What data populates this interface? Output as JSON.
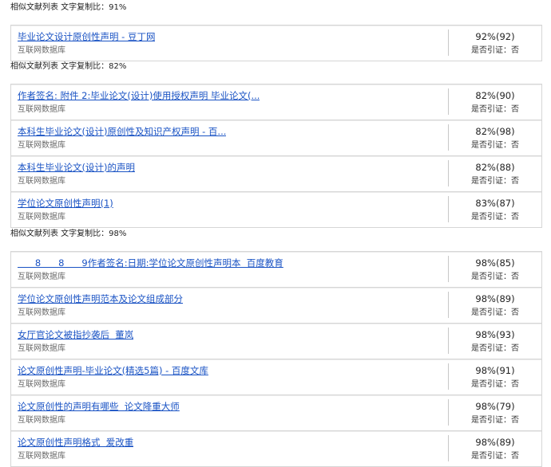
{
  "groups": [
    {
      "heading": "相似文献列表 文字复制比：91%",
      "items": [
        {
          "title": "毕业论文设计原创性声明 - 豆丁网",
          "source": "互联网数据库",
          "score": "92%(92)",
          "cited": "是否引证：否"
        }
      ]
    },
    {
      "heading": "相似文献列表 文字复制比：82%",
      "items": [
        {
          "title": "作者签名: 附件 2:毕业论文(设计)使用授权声明 毕业论文(...",
          "source": "互联网数据库",
          "score": "82%(90)",
          "cited": "是否引证：否"
        },
        {
          "title": "本科生毕业论文(设计)原创性及知识产权声明 - 百...",
          "source": "互联网数据库",
          "score": "82%(98)",
          "cited": "是否引证：否"
        },
        {
          "title": "本科生毕业论文(设计)的声明",
          "source": "互联网数据库",
          "score": "82%(88)",
          "cited": "是否引证：否"
        },
        {
          "title": "学位论文原创性声明(1)",
          "source": "互联网数据库",
          "score": "83%(87)",
          "cited": "是否引证：否"
        }
      ]
    },
    {
      "heading": "相似文献列表 文字复制比：98%",
      "items": [
        {
          "title": "      8      8      9作者签名:日期:学位论文原创性声明本  百度教育",
          "source": "互联网数据库",
          "score": "98%(85)",
          "cited": "是否引证：否"
        },
        {
          "title": "学位论文原创性声明范本及论文组成部分",
          "source": "互联网数据库",
          "score": "98%(89)",
          "cited": "是否引证：否"
        },
        {
          "title": "女厅官论文被指抄袭后  董岚",
          "source": "互联网数据库",
          "score": "98%(93)",
          "cited": "是否引证：否"
        },
        {
          "title": "论文原创性声明-毕业论文(精选5篇) - 百度文库",
          "source": "互联网数据库",
          "score": "98%(91)",
          "cited": "是否引证：否"
        },
        {
          "title": "论文原创性的声明有哪些  论文降重大师",
          "source": "互联网数据库",
          "score": "98%(79)",
          "cited": "是否引证：否"
        },
        {
          "title": "论文原创性声明格式  爱改重",
          "source": "互联网数据库",
          "score": "98%(89)",
          "cited": "是否引证：否"
        }
      ]
    }
  ]
}
